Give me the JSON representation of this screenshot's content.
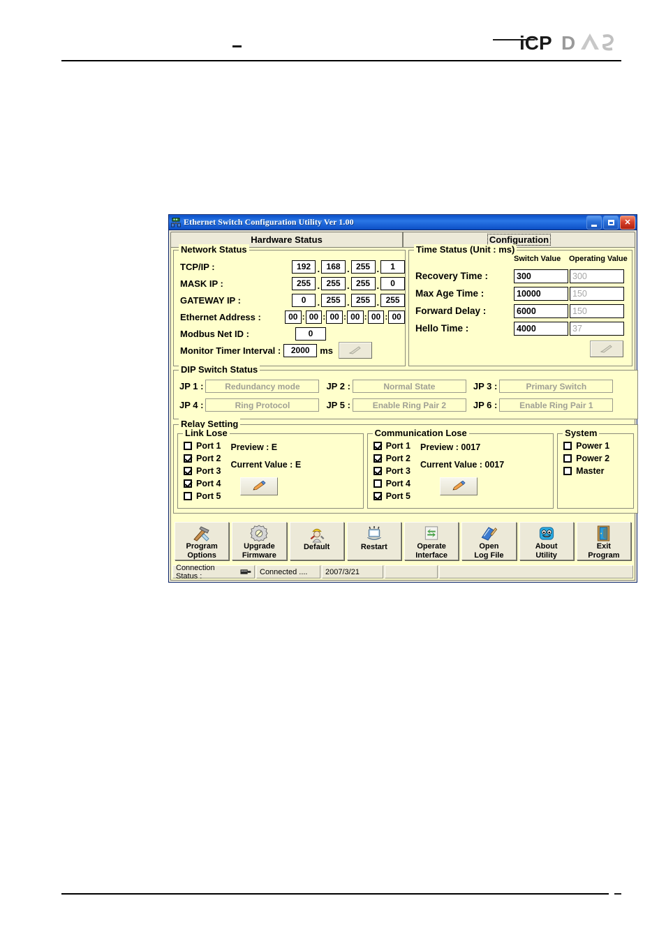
{
  "document": {
    "header_dash": "–",
    "footer_dash": "–",
    "logo_dark": "iCP",
    "logo_light": "DAS"
  },
  "window": {
    "title": "Ethernet Switch Configuration Utility Ver 1.00",
    "title_icon": "ethernet-switch-icon",
    "minimize_label": "Minimize",
    "maximize_label": "Maximize",
    "close_label": "Close"
  },
  "tabs": [
    {
      "label": "Hardware Status",
      "active": true
    },
    {
      "label": "Configuration",
      "active": false,
      "focused": true
    }
  ],
  "network_status": {
    "title": "Network Status",
    "rows": [
      {
        "label": "TCP/IP :",
        "values": [
          "192",
          "168",
          "255",
          "1"
        ],
        "separator": "."
      },
      {
        "label": "MASK IP :",
        "values": [
          "255",
          "255",
          "255",
          "0"
        ],
        "separator": "."
      },
      {
        "label": "GATEWAY IP :",
        "values": [
          "0",
          "255",
          "255",
          "255"
        ],
        "separator": "."
      }
    ],
    "ethernet_address_label": "Ethernet Address :",
    "ethernet_address": [
      "00",
      "00",
      "00",
      "00",
      "00",
      "00"
    ],
    "ethernet_separator": ":",
    "modbus_label": "Modbus Net ID :",
    "modbus_value": "0",
    "monitor_label": "Monitor Timer Interval :",
    "monitor_value": "2000",
    "monitor_unit": "ms",
    "edit_icon": "pencil-icon"
  },
  "time_status": {
    "title": "Time Status (Unit : ms)",
    "col_switch": "Switch Value",
    "col_operating": "Operating Value",
    "rows": [
      {
        "label": "Recovery Time :",
        "switch_value": "300",
        "operating_value": "300"
      },
      {
        "label": "Max Age Time :",
        "switch_value": "10000",
        "operating_value": "150"
      },
      {
        "label": "Forward Delay :",
        "switch_value": "6000",
        "operating_value": "150"
      },
      {
        "label": "Hello Time :",
        "switch_value": "4000",
        "operating_value": "37"
      }
    ],
    "edit_icon": "pencil-icon"
  },
  "dip_switch": {
    "title": "DIP Switch Status",
    "items": [
      {
        "label": "JP 1 :",
        "value": "Redundancy mode"
      },
      {
        "label": "JP 2 :",
        "value": "Normal State"
      },
      {
        "label": "JP 3 :",
        "value": "Primary Switch"
      },
      {
        "label": "JP 4 :",
        "value": "Ring Protocol"
      },
      {
        "label": "JP 5 :",
        "value": "Enable Ring Pair 2"
      },
      {
        "label": "JP 6 :",
        "value": "Enable Ring Pair 1"
      }
    ]
  },
  "relay_setting": {
    "title": "Relay Setting",
    "link_lose": {
      "title": "Link Lose",
      "ports": [
        {
          "label": "Port 1",
          "checked": false
        },
        {
          "label": "Port 2",
          "checked": true
        },
        {
          "label": "Port 3",
          "checked": true
        },
        {
          "label": "Port 4",
          "checked": true
        },
        {
          "label": "Port 5",
          "checked": false
        }
      ],
      "preview": "Preview : E",
      "current": "Current Value : E",
      "edit_icon": "pencil-icon"
    },
    "communication_lose": {
      "title": "Communication Lose",
      "ports": [
        {
          "label": "Port 1",
          "checked": true
        },
        {
          "label": "Port 2",
          "checked": true
        },
        {
          "label": "Port 3",
          "checked": true
        },
        {
          "label": "Port 4",
          "checked": false
        },
        {
          "label": "Port 5",
          "checked": true
        }
      ],
      "preview": "Preview : 0017",
      "current": "Current Value : 0017",
      "edit_icon": "pencil-icon"
    },
    "system": {
      "title": "System",
      "items": [
        {
          "label": "Power 1",
          "checked": false
        },
        {
          "label": "Power 2",
          "checked": false
        },
        {
          "label": "Master",
          "checked": false
        }
      ]
    }
  },
  "toolbar": [
    {
      "line1": "Program",
      "line2": "Options",
      "icon": "hammer-tools-icon"
    },
    {
      "line1": "Upgrade",
      "line2": "Firmware",
      "icon": "gear-icon"
    },
    {
      "line1": "Default",
      "line2": "",
      "icon": "worker-icon"
    },
    {
      "line1": "Restart",
      "line2": "",
      "icon": "computer-restart-icon"
    },
    {
      "line1": "Operate",
      "line2": "Interface",
      "icon": "exchange-arrows-icon"
    },
    {
      "line1": "Open",
      "line2": "Log  File",
      "icon": "book-pencil-icon"
    },
    {
      "line1": "About",
      "line2": "Utility",
      "icon": "smiley-face-icon"
    },
    {
      "line1": "Exit",
      "line2": "Program",
      "icon": "door-exit-icon"
    }
  ],
  "statusbar": {
    "connection_label": "Connection Status :",
    "connection_icon": "network-plug-icon",
    "connection_state": "Connected ....",
    "date": "2007/3/21",
    "cell4": "",
    "cell5": ""
  },
  "colors": {
    "client_bg": "#FFFFCC",
    "chrome_bg": "#ECE9D8",
    "titlebar_blue": "#0A57D0",
    "disabled_text": "#A0A094",
    "close_red": "#D8412A"
  }
}
